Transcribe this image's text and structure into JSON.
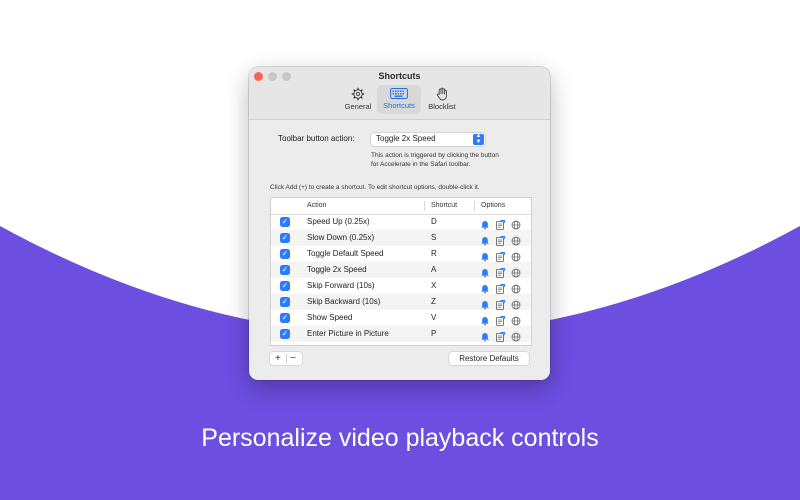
{
  "colors": {
    "background_purple": "#6c4ee0",
    "accent": "#2f7bf5",
    "close": "#fe5f57"
  },
  "window": {
    "title": "Shortcuts",
    "tabs": [
      {
        "label": "General",
        "icon": "gear-icon",
        "active": false
      },
      {
        "label": "Shortcuts",
        "icon": "keyboard-icon",
        "active": true
      },
      {
        "label": "Blocklist",
        "icon": "hand-icon",
        "active": false
      }
    ]
  },
  "toolbar_action": {
    "label": "Toolbar button action:",
    "selected": "Toggle 2x Speed",
    "help_line1": "This action is triggered by clicking the button",
    "help_line2": "for Accelerate in the Safari toolbar."
  },
  "instructions": "Click Add (+) to create a shortcut. To edit shortcut options, double-click it.",
  "table": {
    "columns": {
      "action": "Action",
      "shortcut": "Shortcut",
      "options": "Options"
    },
    "rows": [
      {
        "checked": true,
        "action": "Speed Up (0.25x)",
        "shortcut": "D"
      },
      {
        "checked": true,
        "action": "Slow Down (0.25x)",
        "shortcut": "S"
      },
      {
        "checked": true,
        "action": "Toggle Default Speed",
        "shortcut": "R"
      },
      {
        "checked": true,
        "action": "Toggle 2x Speed",
        "shortcut": "A"
      },
      {
        "checked": true,
        "action": "Skip Forward (10s)",
        "shortcut": "X"
      },
      {
        "checked": true,
        "action": "Skip Backward (10s)",
        "shortcut": "Z"
      },
      {
        "checked": true,
        "action": "Show Speed",
        "shortcut": "V"
      },
      {
        "checked": true,
        "action": "Enter Picture in Picture",
        "shortcut": "P"
      }
    ]
  },
  "footer": {
    "add": "+",
    "remove": "−",
    "restore": "Restore Defaults"
  },
  "caption": "Personalize video playback controls"
}
